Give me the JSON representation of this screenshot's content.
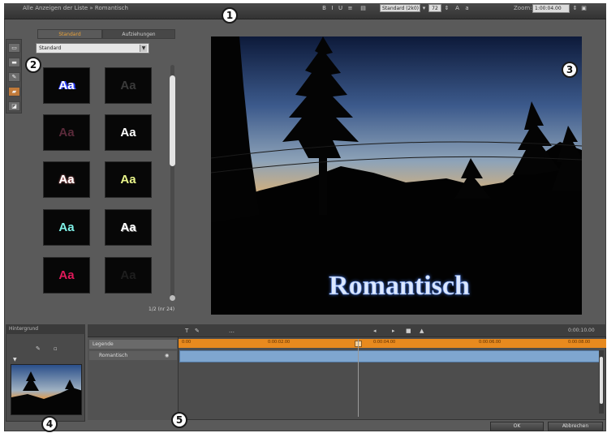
{
  "window": {
    "title": "Alle Anzeigen der Liste » Romantisch",
    "font_name": "Standard (2k0)",
    "font_size": "72",
    "zoom_label": "Zoom:",
    "zoom_value": "1:00:04.00"
  },
  "callouts": [
    "1",
    "2",
    "3",
    "4",
    "5"
  ],
  "style_panel": {
    "tabs": [
      "Standard",
      "Aufziehungen"
    ],
    "dropdown_value": "Standard",
    "page_count": "1/2 (nr 24)",
    "presets": [
      {
        "text": "Aa",
        "color": "#ffffff",
        "accent": "#2a3cff"
      },
      {
        "text": "Aa",
        "color": "#3a3a3a"
      },
      {
        "text": "Aa",
        "color": "#5a2a3a"
      },
      {
        "text": "Aa",
        "color": "#ffffff"
      },
      {
        "text": "Aa",
        "color": "#ffffff"
      },
      {
        "text": "Aa",
        "color": "#e9f58a"
      },
      {
        "text": "Aa",
        "color": "#7ff0e6"
      },
      {
        "text": "Aa",
        "color": "#ffffff"
      },
      {
        "text": "Aa",
        "color": "#e0195a"
      },
      {
        "text": "Aa",
        "color": "#1e1e1e"
      }
    ]
  },
  "left_tools": [
    "video-icon",
    "text-icon",
    "brush-icon",
    "folder-icon",
    "layer-icon"
  ],
  "preview": {
    "overlay_text": "Romantisch",
    "text_color": "#dce8ff",
    "glow_color": "#3f6fd6"
  },
  "bottom_left": {
    "header": "Hintergrund"
  },
  "timeline": {
    "tools": [
      "T",
      "✎",
      "…",
      "◂",
      "▸",
      "■",
      "▲"
    ],
    "time": "0:00:10.00",
    "ruler_marks": [
      "0:00",
      "0:00:02.00",
      "0:00:04.00",
      "0:00:06.00",
      "0:00:08.00"
    ],
    "track_1": "Legende",
    "track_2": "Romantisch",
    "ruler_color": "#e88a1e",
    "clip_color": "#7fa6cf"
  },
  "buttons": {
    "ok": "OK",
    "cancel": "Abbrechen"
  }
}
